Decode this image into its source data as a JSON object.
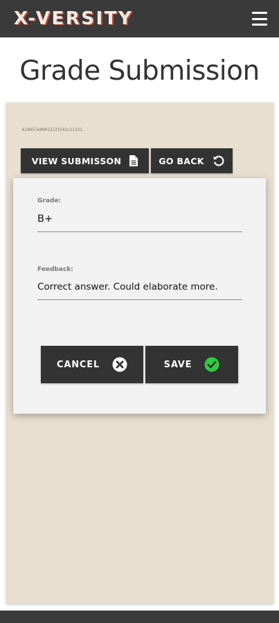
{
  "navbar": {
    "brand": "X-VERSITY",
    "menu_icon": "hamburger-menu-icon"
  },
  "page": {
    "title": "Grade Submission"
  },
  "submission": {
    "id": "610057e0001223f243c11331",
    "view_label": "VIEW SUBMISSON",
    "view_icon": "document-icon",
    "back_label": "GO BACK",
    "back_icon": "undo-icon"
  },
  "form": {
    "grade_label": "Grade:",
    "grade_value": "B+",
    "feedback_label": "Feedback:",
    "feedback_value": "Correct answer. Could elaborate more.",
    "cancel_label": "CANCEL",
    "cancel_icon": "times-circle-icon",
    "save_label": "SAVE",
    "save_icon": "check-circle-icon"
  },
  "colors": {
    "navbar": "#3a3a3a",
    "panel": "#e8dfd0",
    "button": "#333333",
    "save_check": "#2ecc40"
  }
}
